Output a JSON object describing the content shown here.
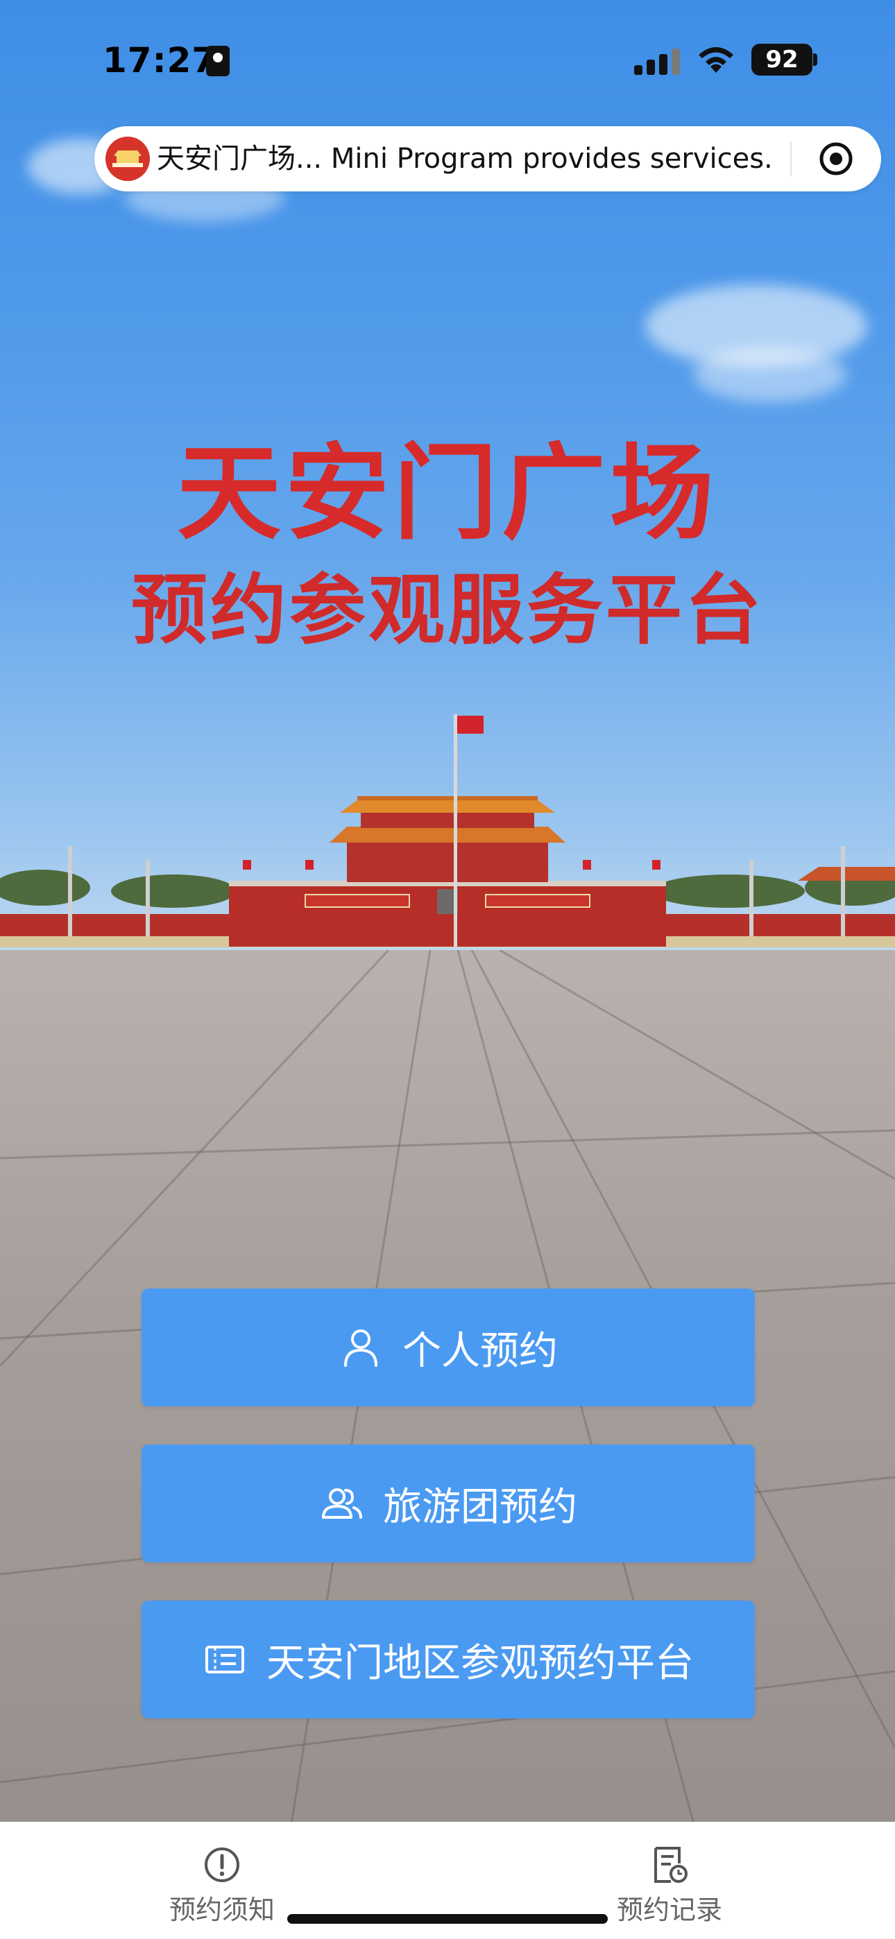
{
  "status_bar": {
    "time": "17:27",
    "battery": "92",
    "icons": [
      "id-card-icon",
      "signal-icon",
      "wifi-icon",
      "battery-icon"
    ]
  },
  "capsule": {
    "text": "天安门广场... Mini Program provides services.",
    "logo_icon": "tiananmen-logo-icon",
    "action_icon": "target-icon"
  },
  "hero": {
    "title": "天安门广场",
    "subtitle": "预约参观服务平台"
  },
  "actions": [
    {
      "label": "个人预约",
      "icon": "person-icon"
    },
    {
      "label": "旅游团预约",
      "icon": "group-icon"
    },
    {
      "label": "天安门地区参观预约平台",
      "icon": "ticket-icon"
    }
  ],
  "tabbar": {
    "items": [
      {
        "label": "预约须知",
        "icon": "exclamation-circle-icon"
      },
      {
        "label": "预约记录",
        "icon": "record-list-icon"
      }
    ]
  },
  "colors": {
    "button": "#4a9af2",
    "title_red": "#d72a2a",
    "sky": "#4d98ea"
  }
}
